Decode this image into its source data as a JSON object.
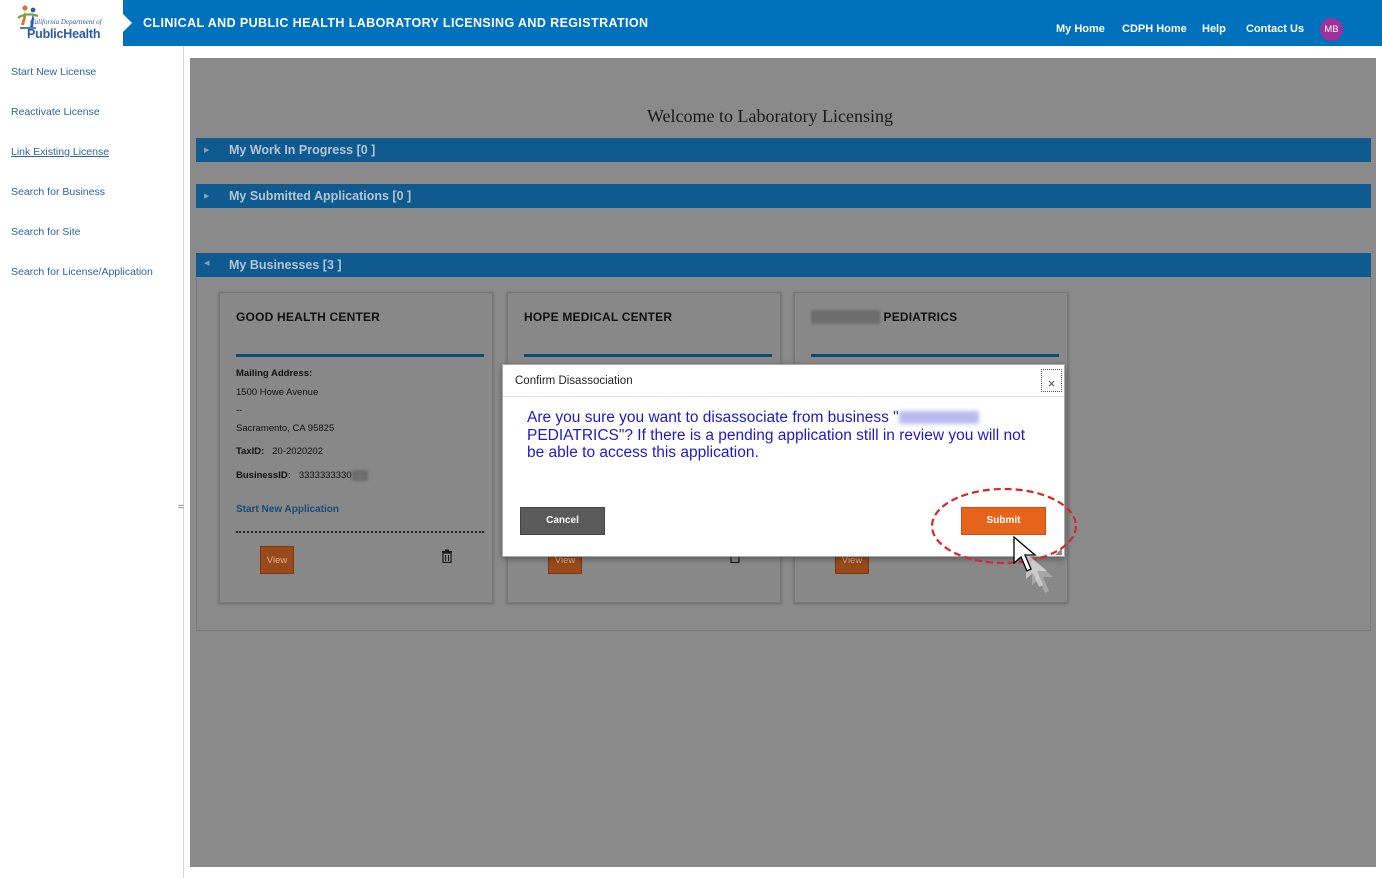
{
  "header": {
    "logo_small": "California Department of",
    "logo_big": "PublicHealth",
    "site_title": "CLINICAL AND PUBLIC HEALTH LABORATORY LICENSING AND REGISTRATION",
    "nav": [
      "My Home",
      "CDPH Home",
      "Help",
      "Contact Us"
    ],
    "avatar_initials": "MB",
    "bar_color": "#0071bc"
  },
  "sidebar": {
    "items": [
      {
        "label": "Start New License"
      },
      {
        "label": "Reactivate License"
      },
      {
        "label": "Link Existing License"
      },
      {
        "label": "Search for Business"
      },
      {
        "label": "Search for Site"
      },
      {
        "label": "Search for License/Application"
      }
    ],
    "resize_handle": "="
  },
  "main": {
    "welcome": "Welcome to Laboratory Licensing",
    "sections": [
      {
        "title": "My Work In Progress [0 ]",
        "icon": "expand-triangle-icon"
      },
      {
        "title": "My Submitted Applications [0 ]",
        "icon": "expand-triangle-icon"
      },
      {
        "title": "My Businesses [3 ]",
        "icon": "collapse-triangle-icon"
      }
    ],
    "cards": [
      {
        "title": "GOOD HEALTH CENTER",
        "mailing_label": "Mailing Address:",
        "address_line1": "1500 Howe Avenue",
        "address_line2": "--",
        "address_line3": "Sacramento, CA 95825",
        "taxid_label": "TaxID:",
        "taxid_value": "20-2020202",
        "businessid_label": "BusinessID:",
        "businessid_value": "3333333330",
        "start_app": "Start New Application",
        "view": "View"
      },
      {
        "title": "HOPE MEDICAL CENTER",
        "view": "View"
      },
      {
        "title": "PEDIATRICS",
        "view": "View"
      }
    ]
  },
  "dialog": {
    "title": "Confirm Disassociation",
    "close_glyph": "×",
    "message_part1": "Are you sure you want to disassociate from business \"",
    "message_part2": "PEDIATRICS\"? If there is a pending application still in review you will not be able to access this application.",
    "cancel": "Cancel",
    "submit": "Submit",
    "accent": "#e5631b",
    "message_color": "#1b1bc9"
  },
  "annotation": {
    "color": "#d9262c",
    "icon": "dashed-ellipse-highlight"
  }
}
